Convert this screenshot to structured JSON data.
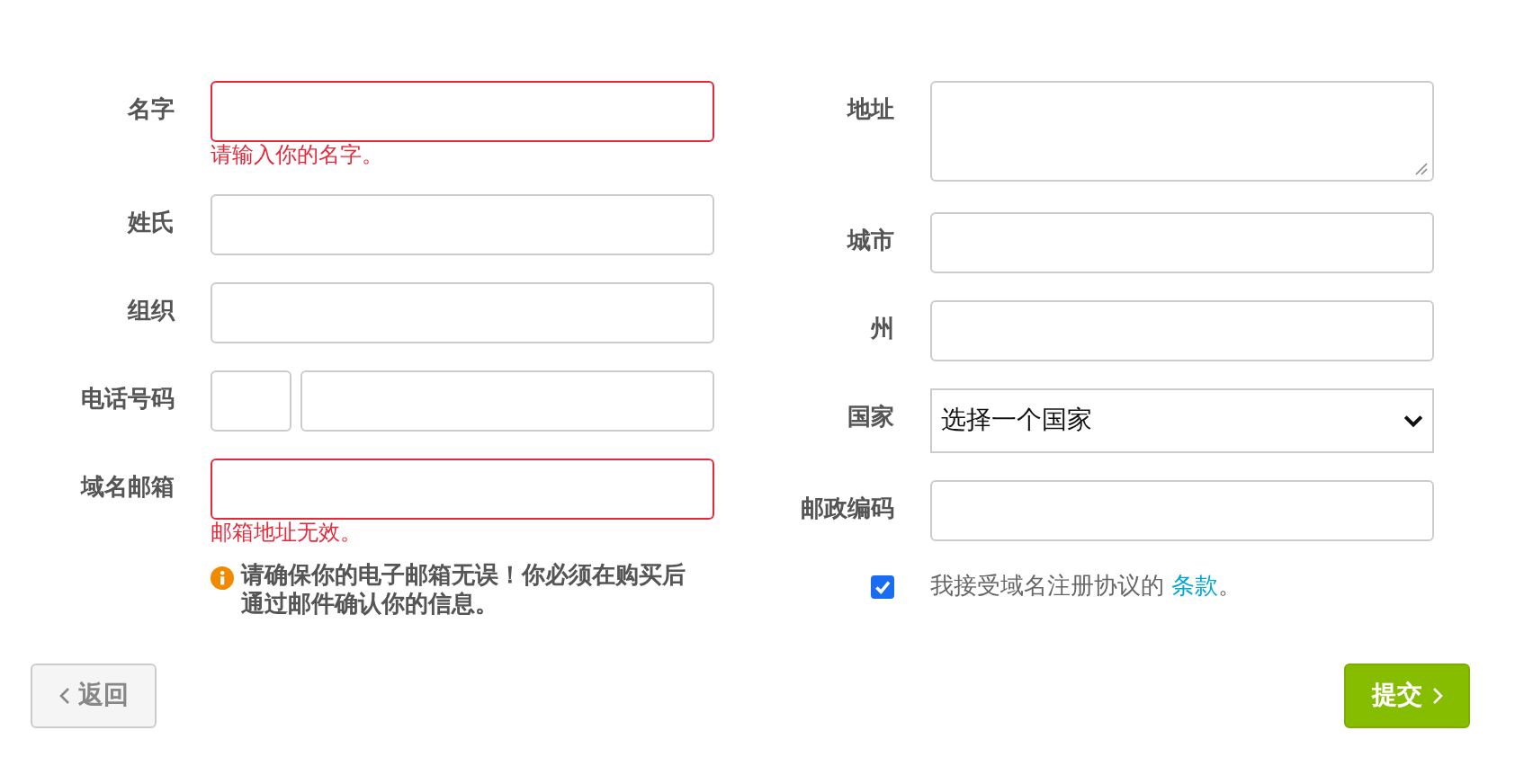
{
  "left_fields": [
    {
      "label": "名字",
      "kind": "text",
      "error": true,
      "error_message": "请输入你的名字。"
    },
    {
      "label": "姓氏",
      "kind": "text",
      "error": false
    },
    {
      "label": "组织",
      "kind": "text",
      "error": false
    },
    {
      "label": "电话号码",
      "kind": "phone",
      "error": false
    },
    {
      "label": "域名邮箱",
      "kind": "text",
      "error": true,
      "error_message": "邮箱地址无效。"
    }
  ],
  "email_notice": "请确保你的电子邮箱无误！你必须在购买后通过邮件确认你的信息。",
  "right_fields": [
    {
      "label": "地址",
      "kind": "textarea",
      "error": false
    },
    {
      "label": "城市",
      "kind": "text",
      "error": false
    },
    {
      "label": "州",
      "kind": "text",
      "error": false
    },
    {
      "label": "国家",
      "kind": "select",
      "value": "选择一个国家",
      "error": false
    },
    {
      "label": "邮政编码",
      "kind": "text",
      "error": false
    }
  ],
  "terms": {
    "checked": true,
    "text": "我接受域名注册协议的 ",
    "link": "条款",
    "suffix": "。"
  },
  "buttons": {
    "back": "返回",
    "submit": "提交"
  }
}
